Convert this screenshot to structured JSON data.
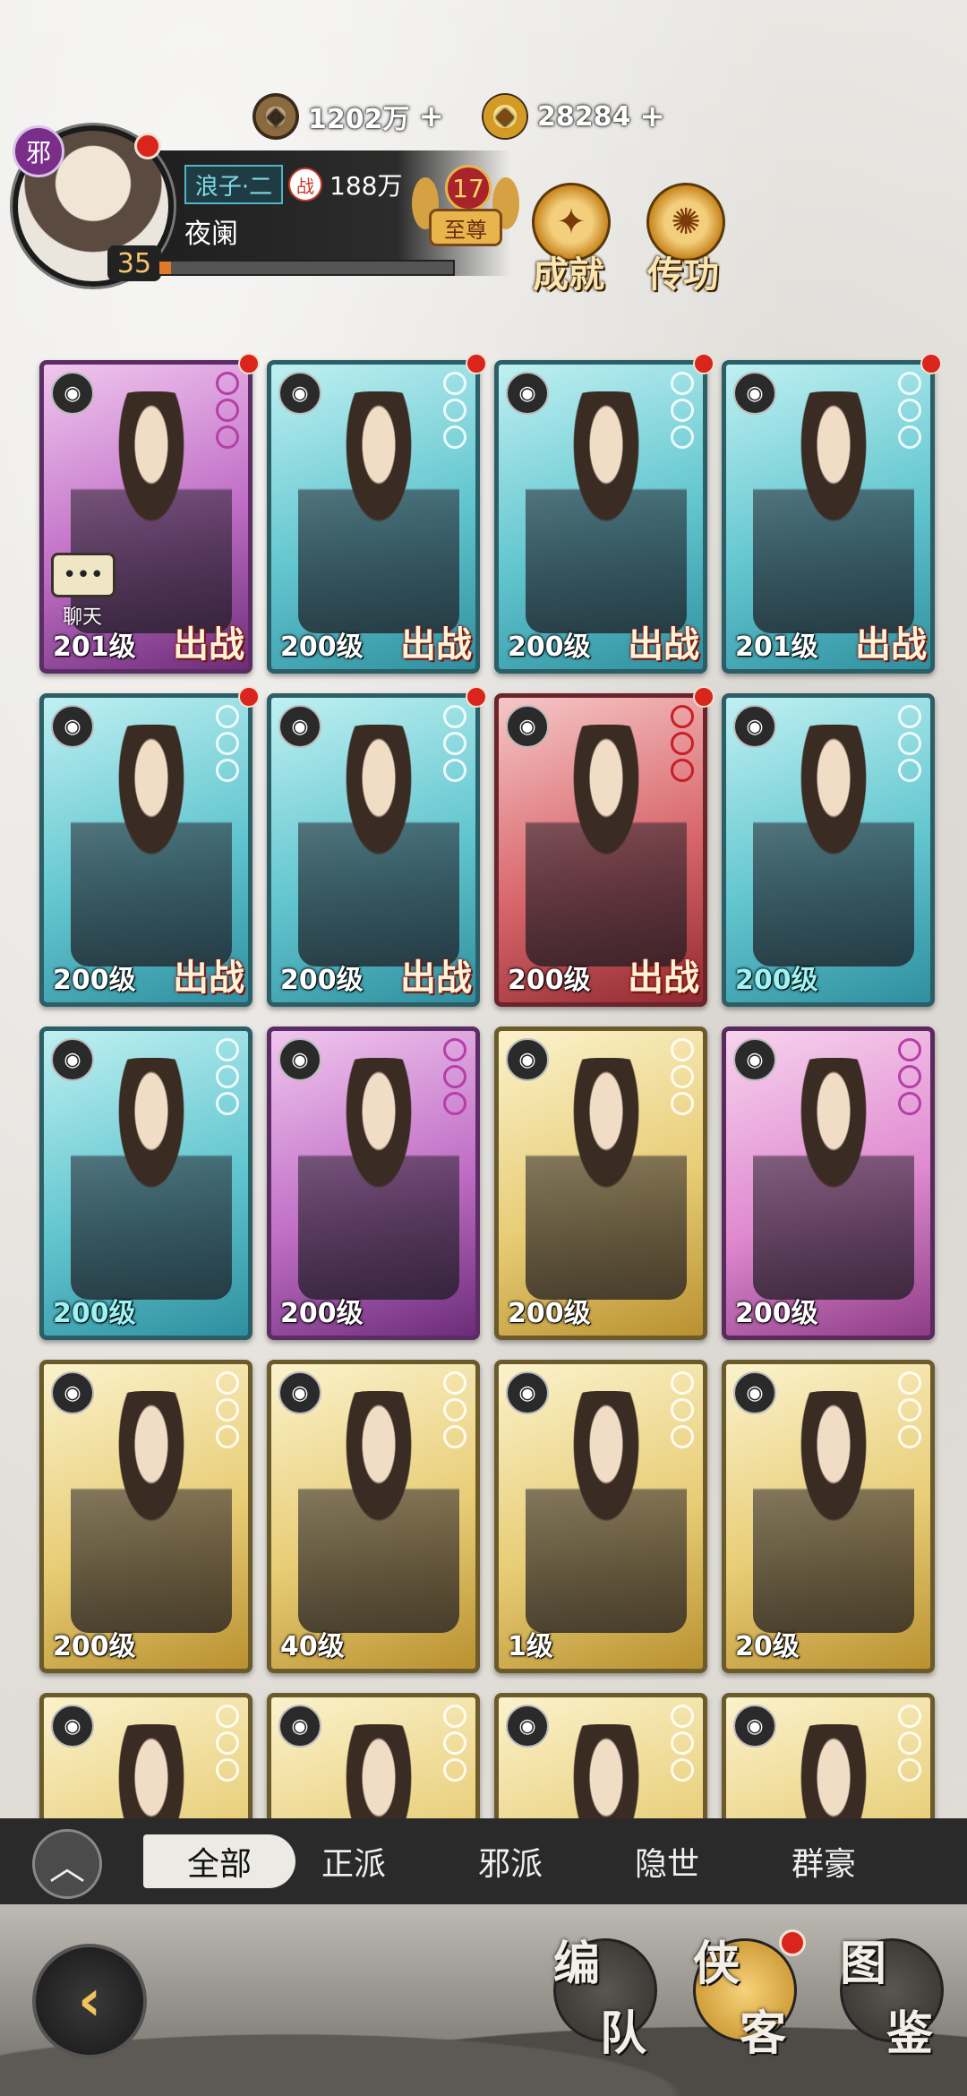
{
  "currency": {
    "coins": "1202万",
    "ingots": "28284"
  },
  "player": {
    "sect_badge": "邪",
    "level": "35",
    "title": "浪子·二",
    "power_icon": "战",
    "power": "188万",
    "name": "夜阑",
    "exp_progress": 0.04,
    "vip_level": "17",
    "vip_label": "至尊"
  },
  "top_buttons": {
    "achievement": "成就",
    "skills": "传功"
  },
  "heroes": [
    {
      "level": "201级",
      "frame": "purple",
      "deployed": true,
      "chat": true,
      "dot": true
    },
    {
      "level": "200级",
      "frame": "cyan",
      "deployed": true,
      "chat": false,
      "dot": true
    },
    {
      "level": "200级",
      "frame": "cyan",
      "deployed": true,
      "chat": false,
      "dot": true
    },
    {
      "level": "201级",
      "frame": "cyan",
      "deployed": true,
      "chat": false,
      "dot": true
    },
    {
      "level": "200级",
      "frame": "cyan",
      "deployed": true,
      "chat": false,
      "dot": true
    },
    {
      "level": "200级",
      "frame": "cyan",
      "deployed": true,
      "chat": false,
      "dot": true
    },
    {
      "level": "200级",
      "frame": "red",
      "deployed": true,
      "chat": false,
      "dot": true
    },
    {
      "level": "200级",
      "frame": "cyan",
      "deployed": false,
      "chat": false,
      "dot": false
    },
    {
      "level": "200级",
      "frame": "cyan",
      "deployed": false,
      "chat": false,
      "dot": false
    },
    {
      "level": "200级",
      "frame": "purple",
      "deployed": false,
      "chat": false,
      "dot": false
    },
    {
      "level": "200级",
      "frame": "yellow",
      "deployed": false,
      "chat": false,
      "dot": false
    },
    {
      "level": "200级",
      "frame": "pink",
      "deployed": false,
      "chat": false,
      "dot": false
    },
    {
      "level": "200级",
      "frame": "yellow",
      "deployed": false,
      "chat": false,
      "dot": false
    },
    {
      "level": "40级",
      "frame": "yellow",
      "deployed": false,
      "chat": false,
      "dot": false
    },
    {
      "level": "1级",
      "frame": "yellow",
      "deployed": false,
      "chat": false,
      "dot": false
    },
    {
      "level": "20级",
      "frame": "yellow",
      "deployed": false,
      "chat": false,
      "dot": false
    },
    {
      "level": "",
      "frame": "yellow",
      "deployed": false,
      "chat": false,
      "dot": false
    },
    {
      "level": "",
      "frame": "yellow",
      "deployed": false,
      "chat": false,
      "dot": false
    },
    {
      "level": "",
      "frame": "yellow",
      "deployed": false,
      "chat": false,
      "dot": false
    },
    {
      "level": "",
      "frame": "yellow",
      "deployed": false,
      "chat": false,
      "dot": false
    }
  ],
  "labels": {
    "deploy": "出战",
    "chat_label": "聊天",
    "chat_icon": "•••"
  },
  "filters": [
    "全部",
    "正派",
    "邪派",
    "隐世",
    "群豪"
  ],
  "active_filter": 0,
  "bottom_nav": [
    {
      "top": "编",
      "bottom": "队",
      "active": false,
      "dot": false
    },
    {
      "top": "侠",
      "bottom": "客",
      "active": true,
      "dot": true
    },
    {
      "top": "图",
      "bottom": "鉴",
      "active": false,
      "dot": false
    }
  ],
  "icons": {
    "coin": "copper-coin-icon",
    "ingot": "gold-ingot-icon",
    "back": "back-arrow-icon",
    "collapse": "chevron-up-icon"
  }
}
